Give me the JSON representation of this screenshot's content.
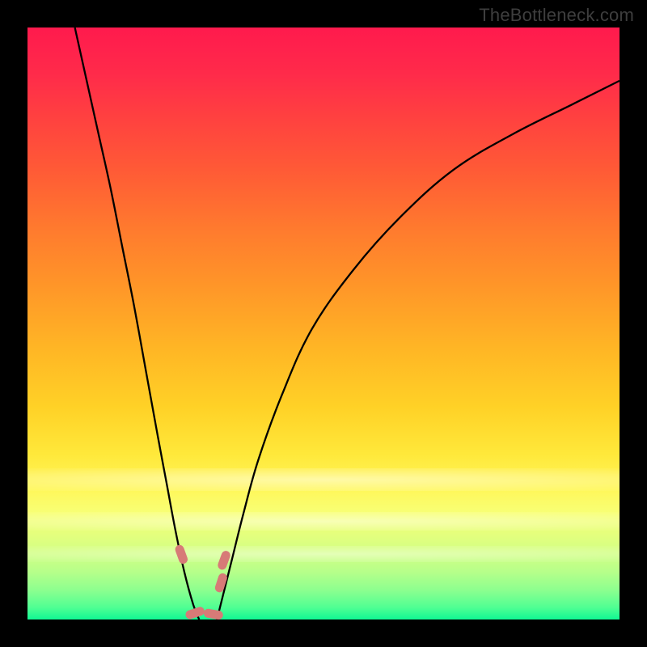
{
  "watermark": "TheBottleneck.com",
  "chart_data": {
    "type": "line",
    "title": "",
    "xlabel": "",
    "ylabel": "",
    "xlim": [
      0,
      100
    ],
    "ylim": [
      0,
      100
    ],
    "series": [
      {
        "name": "left-branch",
        "x": [
          8,
          10,
          12,
          14,
          16,
          18,
          20,
          22,
          23.5,
          25,
          26.5,
          28,
          29
        ],
        "y": [
          100,
          91,
          82,
          73,
          63,
          53,
          42,
          31,
          23,
          15,
          8,
          2.5,
          0
        ]
      },
      {
        "name": "right-branch",
        "x": [
          32,
          33,
          34.5,
          36.5,
          39,
          43,
          48,
          55,
          63,
          72,
          82,
          92,
          100
        ],
        "y": [
          0,
          4,
          10,
          18,
          27,
          38,
          49,
          59,
          68,
          76,
          82,
          87,
          91
        ]
      }
    ],
    "annotations": [
      {
        "name": "pill-left-upper",
        "x": 26.0,
        "y": 11.0,
        "angle_deg": 70
      },
      {
        "name": "pill-right-upper",
        "x": 33.2,
        "y": 10.0,
        "angle_deg": -70
      },
      {
        "name": "pill-right-lower",
        "x": 32.7,
        "y": 6.2,
        "angle_deg": -72
      },
      {
        "name": "pill-bottom-left",
        "x": 28.3,
        "y": 1.1,
        "angle_deg": -18
      },
      {
        "name": "pill-bottom-right",
        "x": 31.4,
        "y": 0.9,
        "angle_deg": 10
      }
    ],
    "gradient_stops": [
      {
        "pos": 0,
        "color": "#ff1a4d"
      },
      {
        "pos": 50,
        "color": "#ffb525"
      },
      {
        "pos": 80,
        "color": "#fff75a"
      },
      {
        "pos": 100,
        "color": "#10f793"
      }
    ]
  }
}
